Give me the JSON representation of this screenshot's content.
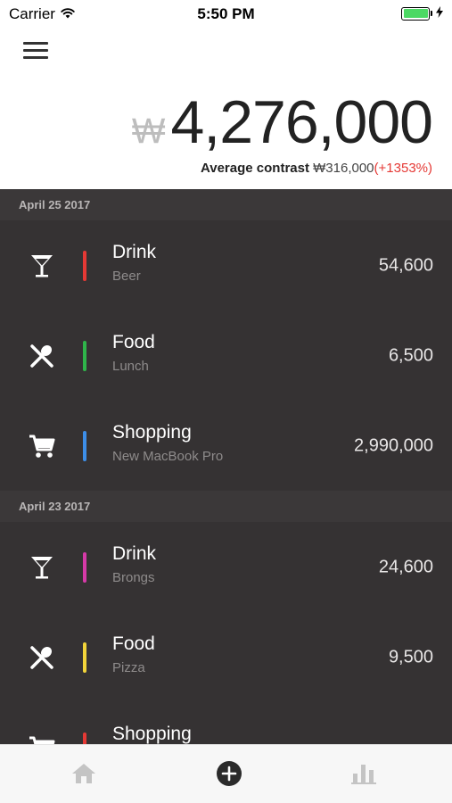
{
  "status_bar": {
    "carrier": "Carrier",
    "time": "5:50 PM",
    "battery_color": "#4cd964"
  },
  "header": {
    "menu_icon": "hamburger-menu-icon",
    "currency_symbol": "₩",
    "total": "4,276,000",
    "average_label": "Average contrast",
    "average_value": "₩316,000",
    "average_delta": "(+1353%)",
    "delta_color": "#e53935"
  },
  "groups": [
    {
      "date": "April 25 2017",
      "items": [
        {
          "category": "Drink",
          "note": "Beer",
          "amount": "54,600",
          "color": "#e53935",
          "icon": "cocktail-glass-icon"
        },
        {
          "category": "Food",
          "note": "Lunch",
          "amount": "6,500",
          "color": "#2fb54a",
          "icon": "fork-knife-icon"
        },
        {
          "category": "Shopping",
          "note": "New MacBook Pro",
          "amount": "2,990,000",
          "color": "#3d8ee8",
          "icon": "shopping-cart-icon"
        }
      ]
    },
    {
      "date": "April 23 2017",
      "items": [
        {
          "category": "Drink",
          "note": "Brongs",
          "amount": "24,600",
          "color": "#d63aa8",
          "icon": "cocktail-glass-icon"
        },
        {
          "category": "Food",
          "note": "Pizza",
          "amount": "9,500",
          "color": "#f2d43a",
          "icon": "fork-knife-icon"
        },
        {
          "category": "Shopping",
          "note": "",
          "amount": "",
          "color": "#e53935",
          "icon": "shopping-cart-icon"
        }
      ]
    }
  ],
  "tab_bar": {
    "tabs": [
      {
        "icon": "home-icon"
      },
      {
        "icon": "add-circle-icon"
      },
      {
        "icon": "bar-chart-icon"
      }
    ]
  }
}
